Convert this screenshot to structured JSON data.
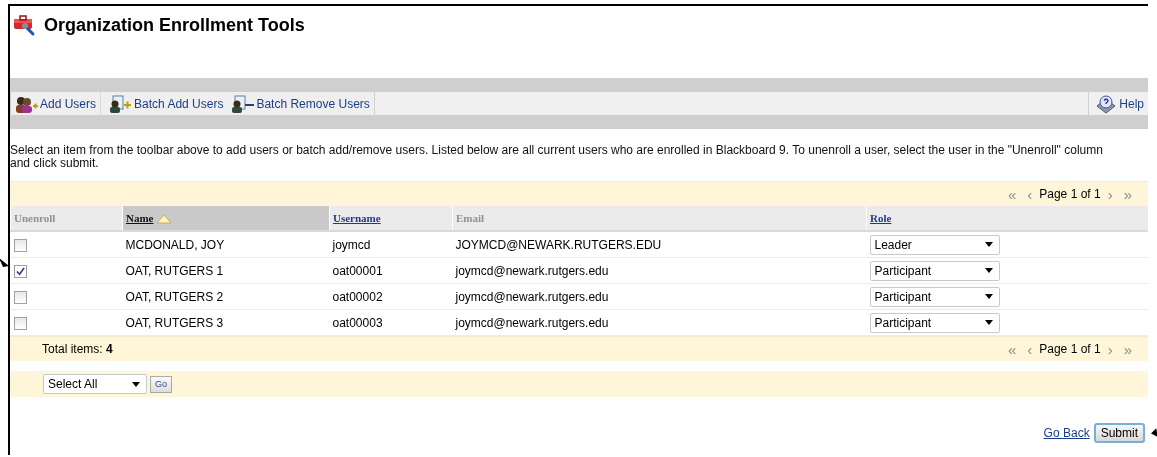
{
  "page": {
    "title": "Organization Enrollment Tools"
  },
  "toolbar": {
    "items": [
      {
        "label": "Add Users",
        "kind": "add"
      },
      {
        "label": "Batch Add Users",
        "kind": "batch-add"
      },
      {
        "label": "Batch Remove Users",
        "kind": "batch-remove"
      }
    ],
    "help": "Help"
  },
  "instructions": "Select an item from the toolbar above to add users or batch add/remove users. Listed below are all current users who are enrolled in Blackboard 9. To unenroll a user, select the user in the \"Unenroll\" column and click submit.",
  "pager_top": {
    "first": "«",
    "previous": "‹",
    "label": "Page 1 of 1",
    "next": "›",
    "last": "»"
  },
  "table": {
    "columns": [
      {
        "label": "Unenroll",
        "kind": "plain",
        "sorted": false
      },
      {
        "label": "Name",
        "kind": "link",
        "sorted": true
      },
      {
        "label": "Username",
        "kind": "link",
        "sorted": false
      },
      {
        "label": "Email",
        "kind": "plain",
        "sorted": false
      },
      {
        "label": "Role",
        "kind": "link",
        "sorted": false
      }
    ],
    "rows": [
      {
        "unenroll": false,
        "name": "MCDONALD, JOY",
        "username": "joymcd",
        "email": "JOYMCD@NEWARK.RUTGERS.EDU",
        "role": "Leader"
      },
      {
        "unenroll": true,
        "name": "OAT, RUTGERS 1",
        "username": "oat00001",
        "email": "joymcd@newark.rutgers.edu",
        "role": "Participant"
      },
      {
        "unenroll": false,
        "name": "OAT, RUTGERS 2",
        "username": "oat00002",
        "email": "joymcd@newark.rutgers.edu",
        "role": "Participant"
      },
      {
        "unenroll": false,
        "name": "OAT, RUTGERS 3",
        "username": "oat00003",
        "email": "joymcd@newark.rutgers.edu",
        "role": "Participant"
      }
    ]
  },
  "total": {
    "label": "Total items:",
    "value": "4"
  },
  "pager_bottom": {
    "first": "«",
    "previous": "‹",
    "label": "Page 1 of 1",
    "next": "›",
    "last": "»"
  },
  "bulk_action": {
    "value": "Select All",
    "button": "Go"
  },
  "footer": {
    "back_link": "Go Back",
    "submit": "Submit"
  }
}
